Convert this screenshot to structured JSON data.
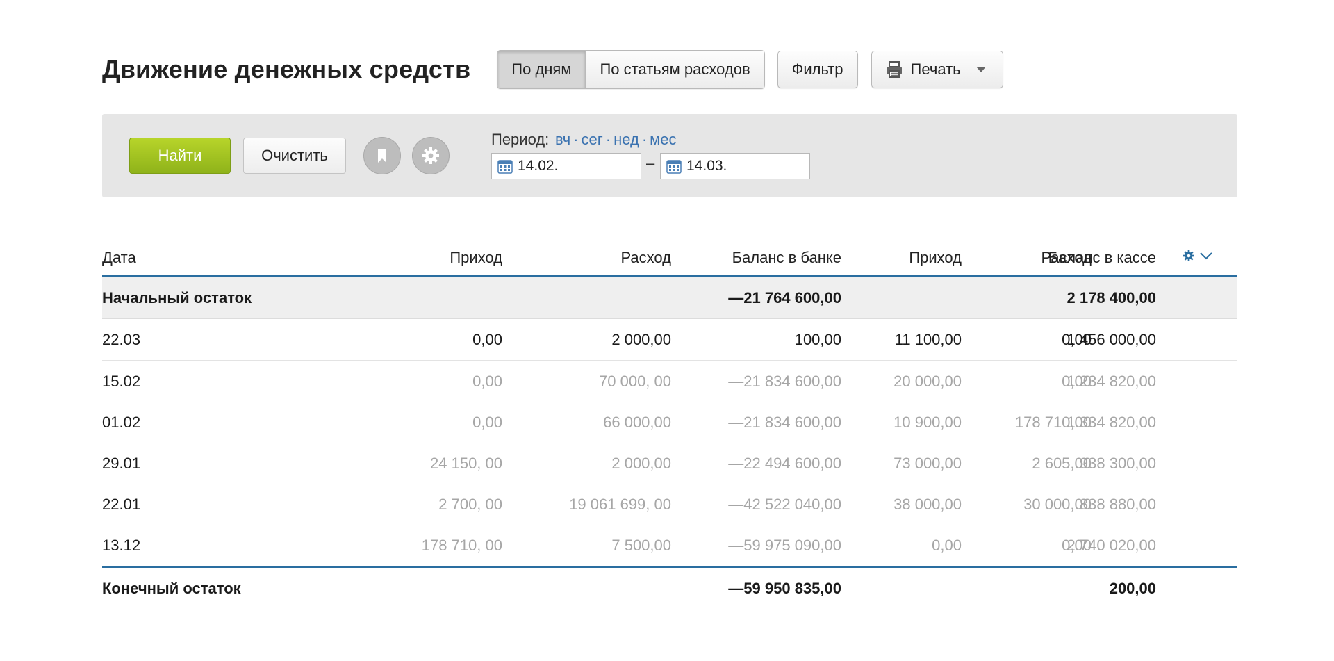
{
  "header": {
    "title": "Движение денежных средств",
    "view_toggle": [
      "По дням",
      "По статьям расходов"
    ],
    "active_view": 0,
    "filter_label": "Фильтр",
    "print_label": "Печать"
  },
  "filterbar": {
    "find_label": "Найти",
    "clear_label": "Очистить",
    "period_label": "Период:",
    "period_links": [
      "вч",
      "сег",
      "нед",
      "мес"
    ],
    "period_separator": "·",
    "date_from": "14.02.",
    "date_to": "14.03.",
    "range_dash": "–"
  },
  "table": {
    "columns": [
      "Дата",
      "Приход",
      "Расход",
      "Баланс в банке",
      "Приход",
      "Расход",
      "Баланс в кассе"
    ],
    "opening": {
      "label": "Начальный остаток",
      "bank_balance": "—21 764 600,00",
      "cash_balance": "2 178 400,00"
    },
    "rows": [
      {
        "date": "22.03",
        "values": [
          "0,00",
          "2 000,00",
          "100,00",
          "11 100,00",
          "0,00",
          "1 456 000,00"
        ],
        "style": "bright"
      },
      {
        "date": "15.02",
        "values": [
          "0,00",
          "70 000, 00",
          "—21 834 600,00",
          "20 000,00",
          "0,00",
          "1 234 820,00"
        ],
        "style": "dim"
      },
      {
        "date": "01.02",
        "values": [
          "0,00",
          "66 000,00",
          "—21 834 600,00",
          "10 900,00",
          "178 710,00",
          "1 334 820,00"
        ],
        "style": "dim"
      },
      {
        "date": "29.01",
        "values": [
          "24 150, 00",
          "2 000,00",
          "—22 494 600,00",
          "73 000,00",
          "2 605,00",
          "938 300,00"
        ],
        "style": "dim"
      },
      {
        "date": "22.01",
        "values": [
          "2 700, 00",
          "19 061 699, 00",
          "—42 522 040,00",
          "38 000,00",
          "30 000,00",
          "838 880,00"
        ],
        "style": "dim"
      },
      {
        "date": "13.12",
        "values": [
          "178 710, 00",
          "7 500,00",
          "—59 975 090,00",
          "0,00",
          "0,00",
          "2 740 020,00"
        ],
        "style": "dim"
      }
    ],
    "closing": {
      "label": "Конечный остаток",
      "bank_balance": "—59 950 835,00",
      "cash_balance": "200,00"
    }
  },
  "colors": {
    "accent_blue": "#2a6ea0",
    "link_blue": "#3a72b0",
    "find_green": "#9fc021",
    "dim_text": "#a6a6a6"
  },
  "icons": {
    "printer": "printer-icon",
    "bookmark": "bookmark-icon",
    "settings": "gear-icon",
    "calendar": "calendar-icon",
    "column_settings": "gear-icon",
    "dropdown": "chevron-down-icon"
  }
}
